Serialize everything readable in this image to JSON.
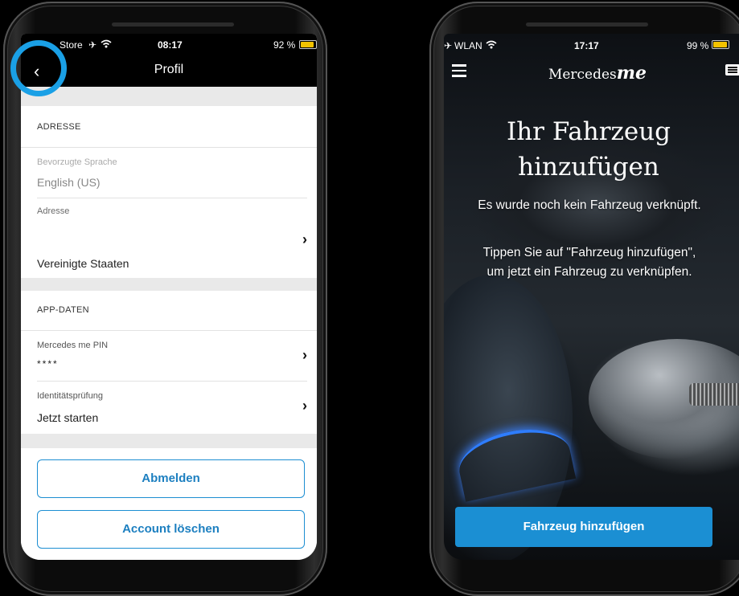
{
  "left_phone": {
    "status": {
      "carrier": "Store",
      "time": "08:17",
      "battery": "92 %",
      "battery_level": 0.92
    },
    "nav": {
      "title": "Profil",
      "back_glyph": "‹"
    },
    "address_section": {
      "header": "ADRESSE",
      "language_label": "Bevorzugte Sprache",
      "language_value": "English (US)",
      "address_label": "Adresse",
      "address_value": "Vereinigte Staaten"
    },
    "app_section": {
      "header": "APP-DATEN",
      "pin_label": "Mercedes me PIN",
      "pin_value": "****",
      "identity_label": "Identitätsprüfung",
      "identity_value": "Jetzt starten"
    },
    "buttons": {
      "logout": "Abmelden",
      "delete_account": "Account löschen"
    },
    "highlight_color": "#1aa0e6"
  },
  "right_phone": {
    "status": {
      "carrier": "WLAN",
      "time": "17:17",
      "battery": "99 %",
      "battery_level": 0.99
    },
    "brand": {
      "name": "Mercedes",
      "suffix": "me"
    },
    "hero": {
      "title_line1": "Ihr Fahrzeug",
      "title_line2": "hinzufügen",
      "text1": "Es wurde noch kein Fahrzeug verknüpft.",
      "text2_line1": "Tippen Sie auf \"Fahrzeug hinzufügen\",",
      "text2_line2": "um jetzt ein Fahrzeug zu verknüpfen."
    },
    "cta": "Fahrzeug hinzufügen",
    "accent": "#1b8fd3"
  },
  "icons": [
    "airplane-icon",
    "wifi-icon",
    "battery-icon",
    "back-icon",
    "chevron-right-icon",
    "menu-icon",
    "message-icon"
  ]
}
